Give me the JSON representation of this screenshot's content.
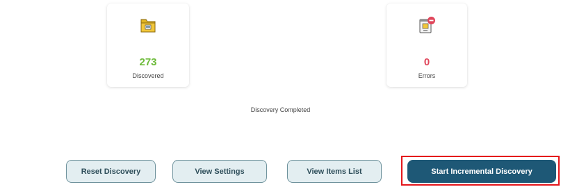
{
  "stats": {
    "discovered": {
      "value": "273",
      "label": "Discovered",
      "icon": "folder-icon",
      "color": "#6dbb3a"
    },
    "errors": {
      "value": "0",
      "label": "Errors",
      "icon": "document-error-icon",
      "color": "#e0455a"
    }
  },
  "status": {
    "text": "Discovery Completed"
  },
  "actions": {
    "reset_label": "Reset Discovery",
    "settings_label": "View Settings",
    "items_label": "View Items List",
    "start_label": "Start Incremental Discovery"
  },
  "colors": {
    "primary": "#1e5876",
    "outline_bg": "#e3eef1",
    "highlight": "#e4161b"
  }
}
